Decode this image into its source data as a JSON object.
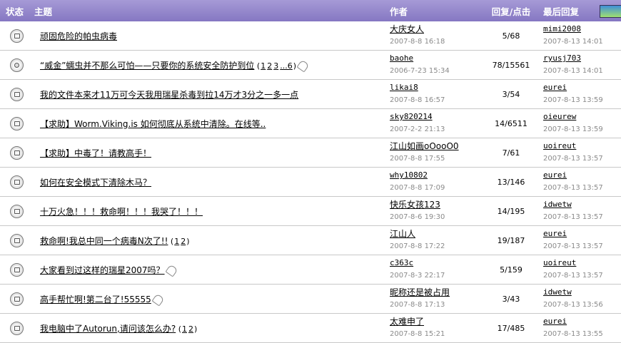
{
  "header": {
    "status": "状态",
    "topic": "主题",
    "author": "作者",
    "replies": "回复/点击",
    "last": "最后回复"
  },
  "rows": [
    {
      "title": "顽固危险的帕虫病毒",
      "pages": [],
      "attachment": false,
      "author": "大庆女人",
      "date": "2007-8-8 16:18",
      "replies": "5/68",
      "last_user": "mimi2008",
      "last_date": "2007-8-13 14:01",
      "icon": "folder-icon"
    },
    {
      "title": "“威金”蠕虫并不那么可怕——只要你的系统安全防护到位",
      "pages": [
        "1",
        "2",
        "3",
        "...6"
      ],
      "attachment": true,
      "author": "baohe",
      "date": "2006-7-23 15:34",
      "replies": "78/15561",
      "last_user": "ryusj703",
      "last_date": "2007-8-13 14:01",
      "icon": "hot-folder-icon"
    },
    {
      "title": "我的文件本来才11万可今天我用瑞星杀毒到拉14万才3分之一多一点",
      "pages": [],
      "attachment": false,
      "author": "likai8",
      "date": "2007-8-8 16:57",
      "replies": "3/54",
      "last_user": "eurei",
      "last_date": "2007-8-13 13:59",
      "icon": "folder-icon"
    },
    {
      "title": "【求助】Worm.Viking.is 如何彻底从系统中清除。在线等..",
      "pages": [],
      "attachment": false,
      "author": "sky820214",
      "date": "2007-2-2 21:13",
      "replies": "14/6511",
      "last_user": "oieurew",
      "last_date": "2007-8-13 13:59",
      "icon": "folder-icon"
    },
    {
      "title": "【求助】中毒了！请教高手！",
      "pages": [],
      "attachment": false,
      "author": "江山如画oOooO0",
      "date": "2007-8-8 17:55",
      "replies": "7/61",
      "last_user": "uoireut",
      "last_date": "2007-8-13 13:57",
      "icon": "folder-icon"
    },
    {
      "title": "如何在安全模式下清除木马？",
      "pages": [],
      "attachment": false,
      "author": "why10802",
      "date": "2007-8-8 17:09",
      "replies": "13/146",
      "last_user": "eurei",
      "last_date": "2007-8-13 13:57",
      "icon": "folder-icon"
    },
    {
      "title": "十万火急！！！救命啊！！！我哭了！！！",
      "pages": [],
      "attachment": false,
      "author": "快乐女孩123",
      "date": "2007-8-6 19:30",
      "replies": "14/195",
      "last_user": "idwetw",
      "last_date": "2007-8-13 13:57",
      "icon": "folder-icon"
    },
    {
      "title": "救命啊!我总中同一个病毒N次了!!",
      "pages": [
        "1",
        "2"
      ],
      "attachment": false,
      "author": "江山人",
      "date": "2007-8-8 17:22",
      "replies": "19/187",
      "last_user": "eurei",
      "last_date": "2007-8-13 13:57",
      "icon": "folder-icon"
    },
    {
      "title": "大家看到过这样的瑞星2007吗？",
      "pages": [],
      "attachment": true,
      "author": "c363c",
      "date": "2007-8-3 22:17",
      "replies": "5/159",
      "last_user": "uoireut",
      "last_date": "2007-8-13 13:57",
      "icon": "folder-icon"
    },
    {
      "title": "高手帮忙啊!第二台了!55555",
      "pages": [],
      "attachment": true,
      "author": "昵称还是被占用",
      "date": "2007-8-8 17:13",
      "replies": "3/43",
      "last_user": "idwetw",
      "last_date": "2007-8-13 13:56",
      "icon": "folder-icon"
    },
    {
      "title": "我电脑中了Autorun,请问该怎么办?",
      "pages": [
        "1",
        "2"
      ],
      "attachment": false,
      "author": "太难申了",
      "date": "2007-8-8 15:21",
      "replies": "17/485",
      "last_user": "eurei",
      "last_date": "2007-8-13 13:55",
      "icon": "folder-icon"
    }
  ]
}
